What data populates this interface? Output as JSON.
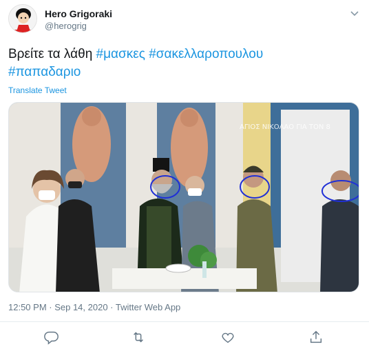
{
  "user": {
    "name": "Hero Grigoraki",
    "handle": "@herogrig"
  },
  "tweet": {
    "text_prefix": "Βρείτε τα λάθη ",
    "hashtags": [
      "#μασκες",
      "#σακελλαροπουλου",
      "#παπαδαριο"
    ],
    "translate_label": "Translate Tweet",
    "timestamp": "12:50 PM · Sep 14, 2020 · Twitter Web App"
  },
  "media": {
    "overlay_caption": "ΑΓΙΟΣ ΝΙΚΟΛΑΟ ΓΙΑ ΤΟΝ 8"
  },
  "icons": {
    "reply": "reply-icon",
    "retweet": "retweet-icon",
    "like": "like-icon",
    "share": "share-icon",
    "caret": "chevron-down-icon",
    "avatar": "avatar"
  },
  "colors": {
    "link": "#1b95e0",
    "muted": "#657786",
    "circle_marks": "#1f2fd6"
  }
}
